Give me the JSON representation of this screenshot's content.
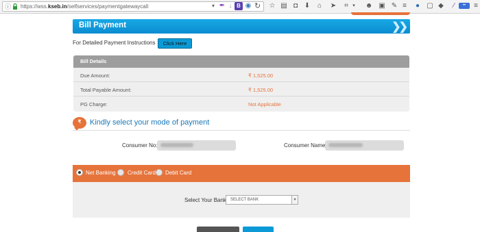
{
  "browser": {
    "url_prefix": "https://wss.",
    "url_domain": "kseb.in",
    "url_path": "/selfservices/paymentgatewaycall"
  },
  "page": {
    "header_title": "Bill Payment",
    "instructions_label": "For Detailed Payment Instructions",
    "click_here_label": "Click Here",
    "bill_details": {
      "heading": "Bill Details",
      "rows": [
        {
          "label": "Due Amount:",
          "value": "₹ 1,525.00"
        },
        {
          "label": "Total Payable Amount:",
          "value": "₹ 1,525.00"
        },
        {
          "label": "PG Charge:",
          "value": "Not Applicable"
        }
      ]
    },
    "mode_title": "Kindly select your mode of payment",
    "consumer_no_label": "Consumer No:",
    "consumer_name_label": "Consumer Name:",
    "payment_options": [
      {
        "label": "Net Banking",
        "selected": true
      },
      {
        "label": "Credit Card",
        "selected": false
      },
      {
        "label": "Debit Card",
        "selected": false
      }
    ],
    "bank_label": "Select Your Bank",
    "bank_select_value": "SELECT BANK"
  },
  "colors": {
    "accent_blue": "#0a8cd1",
    "accent_orange": "#e6733a"
  }
}
